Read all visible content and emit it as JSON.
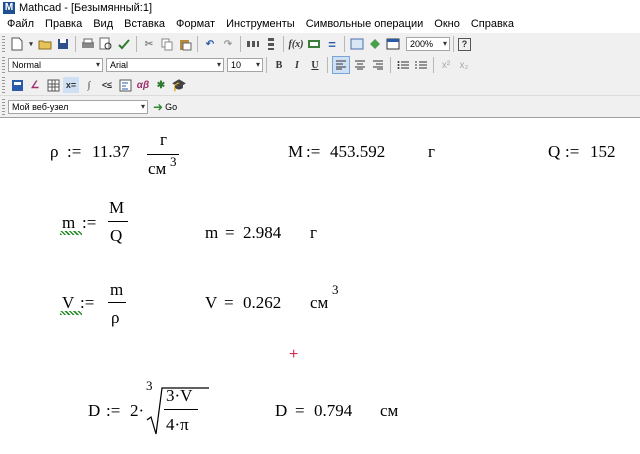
{
  "window": {
    "logo_letter": "M",
    "title": "Mathcad - [Безымянный:1]"
  },
  "menu": [
    "Файл",
    "Правка",
    "Вид",
    "Вставка",
    "Формат",
    "Инструменты",
    "Символьные операции",
    "Окно",
    "Справка"
  ],
  "toolbar": {
    "zoom": "200%"
  },
  "format_bar": {
    "style": "Normal",
    "font": "Arial",
    "size": "10",
    "bold": "B",
    "italic": "I",
    "underline": "U"
  },
  "web_bar": {
    "address": "Мой веб-узел",
    "go": "Go"
  },
  "math": {
    "rho_def": {
      "lhs": "ρ",
      "op": ":=",
      "value": "11.37",
      "unit_num": "г",
      "unit_den": "см",
      "unit_exp": "3"
    },
    "M_def": {
      "lhs": "M",
      "op": ":=",
      "value": "453.592",
      "unit": "г"
    },
    "Q_def": {
      "lhs": "Q",
      "op": ":=",
      "value": "152"
    },
    "m_def": {
      "lhs": "m",
      "op": ":=",
      "num": "M",
      "den": "Q"
    },
    "m_eval": {
      "lhs": "m",
      "op": "=",
      "value": "2.984",
      "unit": "г"
    },
    "V_def": {
      "lhs": "V",
      "op": ":=",
      "num": "m",
      "den": "ρ"
    },
    "V_eval": {
      "lhs": "V",
      "op": "=",
      "value": "0.262",
      "unit": "см",
      "unit_exp": "3"
    },
    "D_def": {
      "lhs": "D",
      "op": ":=",
      "coef": "2·",
      "root_index": "3",
      "num": "3·V",
      "den": "4·π"
    },
    "D_eval": {
      "lhs": "D",
      "op": "=",
      "value": "0.794",
      "unit": "см"
    }
  },
  "cursor": "+"
}
